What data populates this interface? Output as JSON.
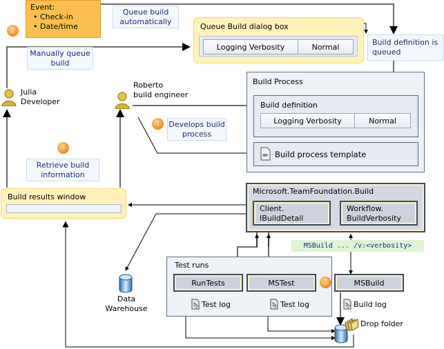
{
  "event": {
    "title": "Event:",
    "items": [
      "Check-in",
      "Date/time"
    ]
  },
  "badges": {
    "develop": "1",
    "queue": "2",
    "test": "3",
    "retrieve": "4"
  },
  "notes": {
    "queue_auto": "Queue build automatically",
    "manual_queue": "Manually queue build",
    "develops": "Develops build process",
    "retrieve": "Retrieve build information",
    "def_queued": "Build definition is queued"
  },
  "queue_dialog": {
    "title": "Queue Build dialog box",
    "key": "Logging Verbosity",
    "value": "Normal"
  },
  "people": {
    "julia": {
      "name": "Julia",
      "role": "Developer"
    },
    "roberto": {
      "name": "Roberto",
      "role": "build engineer"
    }
  },
  "build_process": {
    "title": "Build Process",
    "definition": {
      "title": "Build definition",
      "key": "Logging Verbosity",
      "value": "Normal"
    },
    "template": "Build process template"
  },
  "results_window": {
    "title": "Build results window"
  },
  "tfs": {
    "title": "Microsoft.TeamFoundation.Build",
    "client": [
      "Client.",
      "IBuildDetail"
    ],
    "workflow": [
      "Workflow.",
      "BuildVerbosity"
    ]
  },
  "msbuild_cmd": "MSBuild ... /v:<verbosity>",
  "test_runs": {
    "title": "Test runs",
    "runtests": "RunTests",
    "mstest": "MSTest",
    "log": "Test log"
  },
  "msbuild": {
    "label": "MSBuild",
    "log": "Build log"
  },
  "drop_folder": "Drop folder",
  "warehouse": [
    "Data",
    "Warehouse"
  ],
  "colors": {
    "badge": "#f28c1c",
    "note_text": "#1d2a7a",
    "yellow_panel": "#fff2b8",
    "event": "#fbbf4e"
  }
}
